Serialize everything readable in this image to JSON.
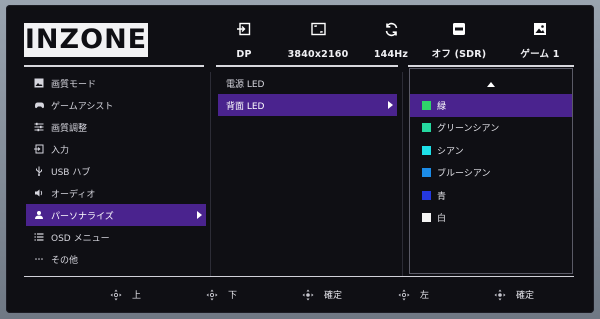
{
  "brand": {
    "logo_text": "INZONE"
  },
  "status_bar": [
    {
      "icon": "input-icon",
      "label": "DP"
    },
    {
      "icon": "resolution-icon",
      "label": "3840x2160"
    },
    {
      "icon": "refresh-rate-icon",
      "label": "144Hz"
    },
    {
      "icon": "hdr-icon",
      "label": "オフ (SDR)"
    },
    {
      "icon": "picture-mode-icon",
      "label": "ゲーム 1"
    }
  ],
  "main_menu": [
    {
      "icon": "picture-mode-icon",
      "label": "画質モード"
    },
    {
      "icon": "gamepad-icon",
      "label": "ゲームアシスト"
    },
    {
      "icon": "sliders-icon",
      "label": "画質調整"
    },
    {
      "icon": "input-icon",
      "label": "入力"
    },
    {
      "icon": "usb-icon",
      "label": "USB ハブ"
    },
    {
      "icon": "speaker-icon",
      "label": "オーディオ"
    },
    {
      "icon": "person-icon",
      "label": "パーソナライズ",
      "selected": true
    },
    {
      "icon": "list-icon",
      "label": "OSD メニュー"
    },
    {
      "icon": "more-icon",
      "label": "その他"
    }
  ],
  "sub_menu": [
    {
      "label": "電源 LED"
    },
    {
      "label": "背面 LED",
      "selected": true
    }
  ],
  "led_colors": [
    {
      "label": "緑",
      "color": "#2fd46a",
      "selected": true
    },
    {
      "label": "グリーンシアン",
      "color": "#25d8a0"
    },
    {
      "label": "シアン",
      "color": "#1ee0e8"
    },
    {
      "label": "ブルーシアン",
      "color": "#1c8ce8"
    },
    {
      "label": "青",
      "color": "#2438e0"
    },
    {
      "label": "白",
      "color": "#f4f4f4"
    }
  ],
  "footer": [
    {
      "icon": "dpad-up-icon",
      "label": "上"
    },
    {
      "icon": "dpad-down-icon",
      "label": "下"
    },
    {
      "icon": "dpad-press-icon",
      "label": "確定"
    },
    {
      "icon": "dpad-left-icon",
      "label": "左"
    },
    {
      "icon": "dpad-press-icon",
      "label": "確定"
    }
  ],
  "colors": {
    "accent": "#4a238e",
    "background": "#0f0f14",
    "text": "#e8e8ee"
  }
}
